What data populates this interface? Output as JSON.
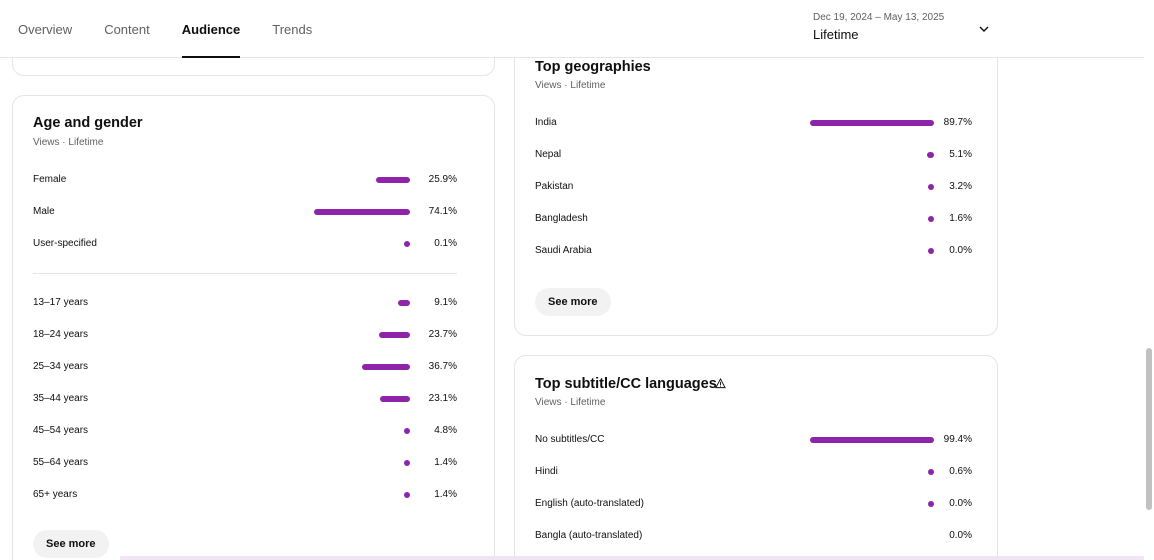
{
  "colors": {
    "accent": "#8e24aa",
    "text": "#0f0f0f",
    "muted": "#606060"
  },
  "header": {
    "tabs": [
      {
        "label": "Overview",
        "active": false
      },
      {
        "label": "Content",
        "active": false
      },
      {
        "label": "Audience",
        "active": true
      },
      {
        "label": "Trends",
        "active": false
      }
    ],
    "date_picker": {
      "range": "Dec 19, 2024 – May 13, 2025",
      "period": "Lifetime",
      "icon": "chevron-down-icon"
    }
  },
  "age_gender": {
    "title": "Age and gender",
    "subtitle": "Views · Lifetime",
    "gender": [
      {
        "label": "Female",
        "value": "25.9%",
        "pct": 25.9
      },
      {
        "label": "Male",
        "value": "74.1%",
        "pct": 74.1
      },
      {
        "label": "User-specified",
        "value": "0.1%",
        "pct": 0.1
      }
    ],
    "age": [
      {
        "label": "13–17 years",
        "value": "9.1%",
        "pct": 9.1
      },
      {
        "label": "18–24 years",
        "value": "23.7%",
        "pct": 23.7
      },
      {
        "label": "25–34 years",
        "value": "36.7%",
        "pct": 36.7
      },
      {
        "label": "35–44 years",
        "value": "23.1%",
        "pct": 23.1
      },
      {
        "label": "45–54 years",
        "value": "4.8%",
        "pct": 4.8
      },
      {
        "label": "55–64 years",
        "value": "1.4%",
        "pct": 1.4
      },
      {
        "label": "65+ years",
        "value": "1.4%",
        "pct": 1.4
      }
    ],
    "see_more": "See more"
  },
  "geographies": {
    "title": "Top geographies",
    "subtitle": "Views · Lifetime",
    "rows": [
      {
        "label": "India",
        "value": "89.7%",
        "pct": 89.7
      },
      {
        "label": "Nepal",
        "value": "5.1%",
        "pct": 5.1
      },
      {
        "label": "Pakistan",
        "value": "3.2%",
        "pct": 3.2
      },
      {
        "label": "Bangladesh",
        "value": "1.6%",
        "pct": 1.6
      },
      {
        "label": "Saudi Arabia",
        "value": "0.0%",
        "pct": 0.0
      }
    ],
    "see_more": "See more"
  },
  "subtitles": {
    "title": "Top subtitle/CC languages",
    "icon": "warning-icon",
    "subtitle": "Views · Lifetime",
    "rows": [
      {
        "label": "No subtitles/CC",
        "value": "99.4%",
        "pct": 99.4,
        "dot": true
      },
      {
        "label": "Hindi",
        "value": "0.6%",
        "pct": 0.6,
        "dot": true
      },
      {
        "label": "English (auto-translated)",
        "value": "0.0%",
        "pct": 0.0,
        "dot": true
      },
      {
        "label": "Bangla (auto-translated)",
        "value": "0.0%",
        "pct": 0.0,
        "dot": false
      }
    ]
  },
  "scrollbar": {
    "position": 0.62
  }
}
